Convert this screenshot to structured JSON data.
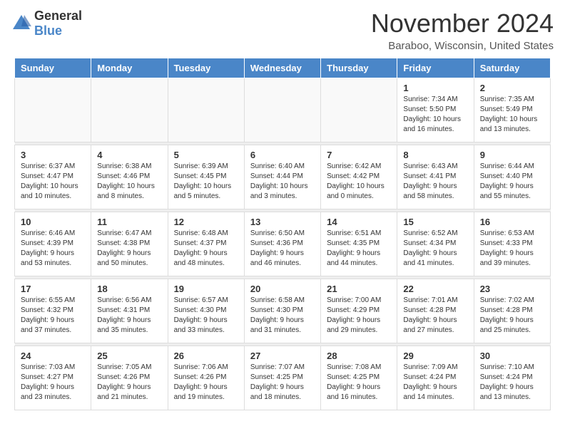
{
  "header": {
    "logo_general": "General",
    "logo_blue": "Blue",
    "month_title": "November 2024",
    "location": "Baraboo, Wisconsin, United States"
  },
  "days_of_week": [
    "Sunday",
    "Monday",
    "Tuesday",
    "Wednesday",
    "Thursday",
    "Friday",
    "Saturday"
  ],
  "weeks": [
    [
      {
        "day": "",
        "info": ""
      },
      {
        "day": "",
        "info": ""
      },
      {
        "day": "",
        "info": ""
      },
      {
        "day": "",
        "info": ""
      },
      {
        "day": "",
        "info": ""
      },
      {
        "day": "1",
        "info": "Sunrise: 7:34 AM\nSunset: 5:50 PM\nDaylight: 10 hours and 16 minutes."
      },
      {
        "day": "2",
        "info": "Sunrise: 7:35 AM\nSunset: 5:49 PM\nDaylight: 10 hours and 13 minutes."
      }
    ],
    [
      {
        "day": "3",
        "info": "Sunrise: 6:37 AM\nSunset: 4:47 PM\nDaylight: 10 hours and 10 minutes."
      },
      {
        "day": "4",
        "info": "Sunrise: 6:38 AM\nSunset: 4:46 PM\nDaylight: 10 hours and 8 minutes."
      },
      {
        "day": "5",
        "info": "Sunrise: 6:39 AM\nSunset: 4:45 PM\nDaylight: 10 hours and 5 minutes."
      },
      {
        "day": "6",
        "info": "Sunrise: 6:40 AM\nSunset: 4:44 PM\nDaylight: 10 hours and 3 minutes."
      },
      {
        "day": "7",
        "info": "Sunrise: 6:42 AM\nSunset: 4:42 PM\nDaylight: 10 hours and 0 minutes."
      },
      {
        "day": "8",
        "info": "Sunrise: 6:43 AM\nSunset: 4:41 PM\nDaylight: 9 hours and 58 minutes."
      },
      {
        "day": "9",
        "info": "Sunrise: 6:44 AM\nSunset: 4:40 PM\nDaylight: 9 hours and 55 minutes."
      }
    ],
    [
      {
        "day": "10",
        "info": "Sunrise: 6:46 AM\nSunset: 4:39 PM\nDaylight: 9 hours and 53 minutes."
      },
      {
        "day": "11",
        "info": "Sunrise: 6:47 AM\nSunset: 4:38 PM\nDaylight: 9 hours and 50 minutes."
      },
      {
        "day": "12",
        "info": "Sunrise: 6:48 AM\nSunset: 4:37 PM\nDaylight: 9 hours and 48 minutes."
      },
      {
        "day": "13",
        "info": "Sunrise: 6:50 AM\nSunset: 4:36 PM\nDaylight: 9 hours and 46 minutes."
      },
      {
        "day": "14",
        "info": "Sunrise: 6:51 AM\nSunset: 4:35 PM\nDaylight: 9 hours and 44 minutes."
      },
      {
        "day": "15",
        "info": "Sunrise: 6:52 AM\nSunset: 4:34 PM\nDaylight: 9 hours and 41 minutes."
      },
      {
        "day": "16",
        "info": "Sunrise: 6:53 AM\nSunset: 4:33 PM\nDaylight: 9 hours and 39 minutes."
      }
    ],
    [
      {
        "day": "17",
        "info": "Sunrise: 6:55 AM\nSunset: 4:32 PM\nDaylight: 9 hours and 37 minutes."
      },
      {
        "day": "18",
        "info": "Sunrise: 6:56 AM\nSunset: 4:31 PM\nDaylight: 9 hours and 35 minutes."
      },
      {
        "day": "19",
        "info": "Sunrise: 6:57 AM\nSunset: 4:30 PM\nDaylight: 9 hours and 33 minutes."
      },
      {
        "day": "20",
        "info": "Sunrise: 6:58 AM\nSunset: 4:30 PM\nDaylight: 9 hours and 31 minutes."
      },
      {
        "day": "21",
        "info": "Sunrise: 7:00 AM\nSunset: 4:29 PM\nDaylight: 9 hours and 29 minutes."
      },
      {
        "day": "22",
        "info": "Sunrise: 7:01 AM\nSunset: 4:28 PM\nDaylight: 9 hours and 27 minutes."
      },
      {
        "day": "23",
        "info": "Sunrise: 7:02 AM\nSunset: 4:28 PM\nDaylight: 9 hours and 25 minutes."
      }
    ],
    [
      {
        "day": "24",
        "info": "Sunrise: 7:03 AM\nSunset: 4:27 PM\nDaylight: 9 hours and 23 minutes."
      },
      {
        "day": "25",
        "info": "Sunrise: 7:05 AM\nSunset: 4:26 PM\nDaylight: 9 hours and 21 minutes."
      },
      {
        "day": "26",
        "info": "Sunrise: 7:06 AM\nSunset: 4:26 PM\nDaylight: 9 hours and 19 minutes."
      },
      {
        "day": "27",
        "info": "Sunrise: 7:07 AM\nSunset: 4:25 PM\nDaylight: 9 hours and 18 minutes."
      },
      {
        "day": "28",
        "info": "Sunrise: 7:08 AM\nSunset: 4:25 PM\nDaylight: 9 hours and 16 minutes."
      },
      {
        "day": "29",
        "info": "Sunrise: 7:09 AM\nSunset: 4:24 PM\nDaylight: 9 hours and 14 minutes."
      },
      {
        "day": "30",
        "info": "Sunrise: 7:10 AM\nSunset: 4:24 PM\nDaylight: 9 hours and 13 minutes."
      }
    ]
  ]
}
